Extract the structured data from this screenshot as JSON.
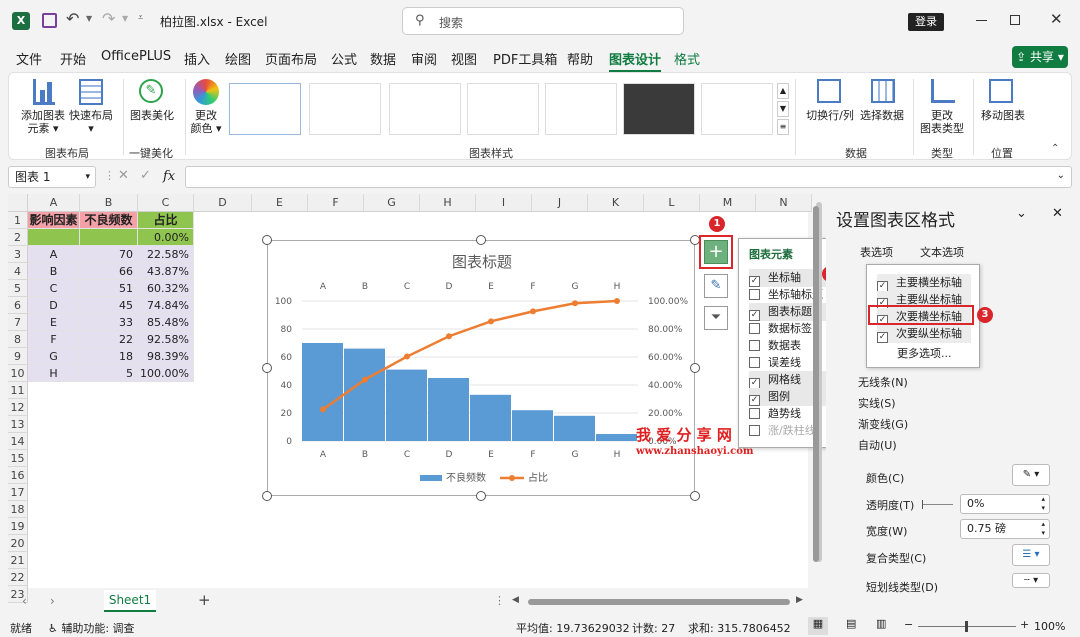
{
  "titlebar": {
    "filename": "柏拉图.xlsx",
    "separator": "-",
    "app": "Excel",
    "search_placeholder": "搜索",
    "login": "登录",
    "share": "共享"
  },
  "menu": {
    "tabs": [
      "文件",
      "开始",
      "OfficePLUS",
      "插入",
      "绘图",
      "页面布局",
      "公式",
      "数据",
      "审阅",
      "视图",
      "PDF工具箱",
      "帮助",
      "图表设计",
      "格式"
    ],
    "active": "图表设计"
  },
  "ribbon": {
    "add_element": "添加图表",
    "add_element2": "元素",
    "quick_layout": "快速布局",
    "beautify": "图表美化",
    "change_color": "更改",
    "change_color2": "颜色",
    "switch_rowcol": "切换行/列",
    "select_data": "选择数据",
    "change_type": "更改",
    "change_type2": "图表类型",
    "move_chart": "移动图表",
    "groups": {
      "layout": "图表布局",
      "beauty": "一键美化",
      "styles": "图表样式",
      "data": "数据",
      "type": "类型",
      "location": "位置"
    }
  },
  "formula": {
    "namebox": "图表 1",
    "fx": "fx"
  },
  "sheet": {
    "columns": [
      "A",
      "B",
      "C",
      "D",
      "E",
      "F",
      "G",
      "H",
      "I",
      "J",
      "K",
      "L",
      "M",
      "N"
    ],
    "rows": [
      "1",
      "2",
      "3",
      "4",
      "5",
      "6",
      "7",
      "8",
      "9",
      "10",
      "11",
      "12",
      "13",
      "14",
      "15",
      "16",
      "17",
      "18",
      "19",
      "20",
      "21",
      "22",
      "23"
    ],
    "headers": [
      "影响因素",
      "不良频数",
      "占比"
    ],
    "row2": [
      "",
      "",
      "0.00%"
    ],
    "data": [
      [
        "A",
        "70",
        "22.58%"
      ],
      [
        "B",
        "66",
        "43.87%"
      ],
      [
        "C",
        "51",
        "60.32%"
      ],
      [
        "D",
        "45",
        "74.84%"
      ],
      [
        "E",
        "33",
        "85.48%"
      ],
      [
        "F",
        "22",
        "92.58%"
      ],
      [
        "G",
        "18",
        "98.39%"
      ],
      [
        "H",
        "5",
        "100.00%"
      ]
    ]
  },
  "chart_data": {
    "type": "bar",
    "title": "图表标题",
    "categories": [
      "A",
      "B",
      "C",
      "D",
      "E",
      "F",
      "G",
      "H"
    ],
    "series": [
      {
        "name": "不良频数",
        "type": "bar",
        "values": [
          70,
          66,
          51,
          45,
          33,
          22,
          18,
          5
        ]
      },
      {
        "name": "占比",
        "type": "line",
        "values": [
          22.58,
          43.87,
          60.32,
          74.84,
          85.48,
          92.58,
          98.39,
          100.0
        ]
      }
    ],
    "y_ticks": [
      "0",
      "20",
      "40",
      "60",
      "80",
      "100"
    ],
    "y2_ticks": [
      "0.00%",
      "20.00%",
      "40.00%",
      "60.00%",
      "80.00%",
      "100.00%"
    ],
    "ylim": [
      0,
      100
    ],
    "y2lim": [
      0,
      100
    ],
    "legend": "bottom",
    "bar_color": "#5b9bd5",
    "line_color": "#ed7d31"
  },
  "watermark": {
    "line1": "我 爱 分 享 网",
    "line2": "www.zhanshaoyi.com"
  },
  "flyout": {
    "title": "图表元素",
    "items": [
      {
        "label": "坐标轴",
        "checked": true
      },
      {
        "label": "坐标轴标题",
        "checked": false
      },
      {
        "label": "图表标题",
        "checked": true
      },
      {
        "label": "数据标签",
        "checked": false
      },
      {
        "label": "数据表",
        "checked": false
      },
      {
        "label": "误差线",
        "checked": false
      },
      {
        "label": "网格线",
        "checked": true
      },
      {
        "label": "图例",
        "checked": true
      },
      {
        "label": "趋势线",
        "checked": false
      },
      {
        "label": "涨/跌柱线",
        "checked": false
      }
    ],
    "sub": [
      {
        "label": "主要横坐标轴",
        "checked": true
      },
      {
        "label": "主要纵坐标轴",
        "checked": true
      },
      {
        "label": "次要横坐标轴",
        "checked": true
      },
      {
        "label": "次要纵坐标轴",
        "checked": true
      }
    ],
    "more": "更多选项...",
    "badges": [
      "1",
      "2",
      "3"
    ]
  },
  "panel": {
    "title": "设置图表区格式",
    "tab1": "表选项",
    "tab2": "文本选项",
    "line_opts": [
      "无线条(N)",
      "实线(S)",
      "渐变线(G)",
      "自动(U)"
    ],
    "color": "颜色(C)",
    "transparency": "透明度(T)",
    "transparency_val": "0%",
    "width": "宽度(W)",
    "width_val": "0.75 磅",
    "compound": "复合类型(C)",
    "dash": "短划线类型(D)"
  },
  "sheets": {
    "tab": "Sheet1",
    "add": "+"
  },
  "status": {
    "ready": "就绪",
    "accessibility": "辅助功能: 调查",
    "avg": "平均值: 19.73629032",
    "count": "计数: 27",
    "sum": "求和: 315.7806452",
    "zoom": "100%"
  }
}
